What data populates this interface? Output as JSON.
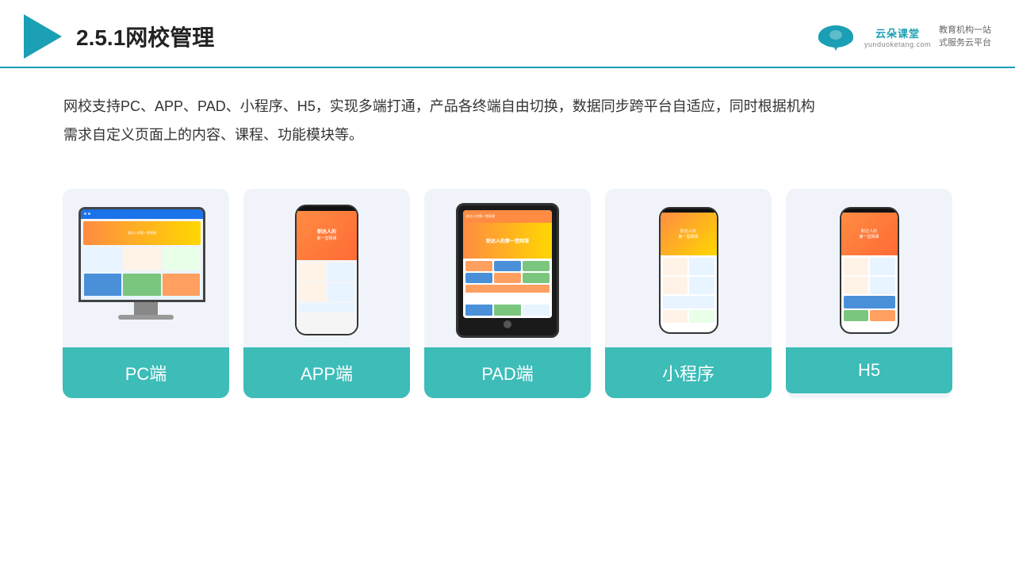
{
  "header": {
    "title": "2.5.1网校管理",
    "brand": {
      "name": "云朵课堂",
      "pinyin": "yunduoketang.com",
      "slogan_line1": "教育机构一站",
      "slogan_line2": "式服务云平台"
    }
  },
  "description": {
    "text": "网校支持PC、APP、PAD、小程序、H5，实现多端打通，产品各终端自由切换，数据同步跨平台自适应，同时根据机构需求自定义页面上的内容、课程、功能模块等。"
  },
  "cards": [
    {
      "id": "pc",
      "label": "PC端"
    },
    {
      "id": "app",
      "label": "APP端"
    },
    {
      "id": "pad",
      "label": "PAD端"
    },
    {
      "id": "miniprogram",
      "label": "小程序"
    },
    {
      "id": "h5",
      "label": "H5"
    }
  ],
  "colors": {
    "accent": "#3dbcb8",
    "header_line": "#1a9fb5",
    "title_color": "#222222",
    "text_color": "#333333",
    "card_bg": "#f0f4fa",
    "brand_color": "#1a9fb5"
  }
}
